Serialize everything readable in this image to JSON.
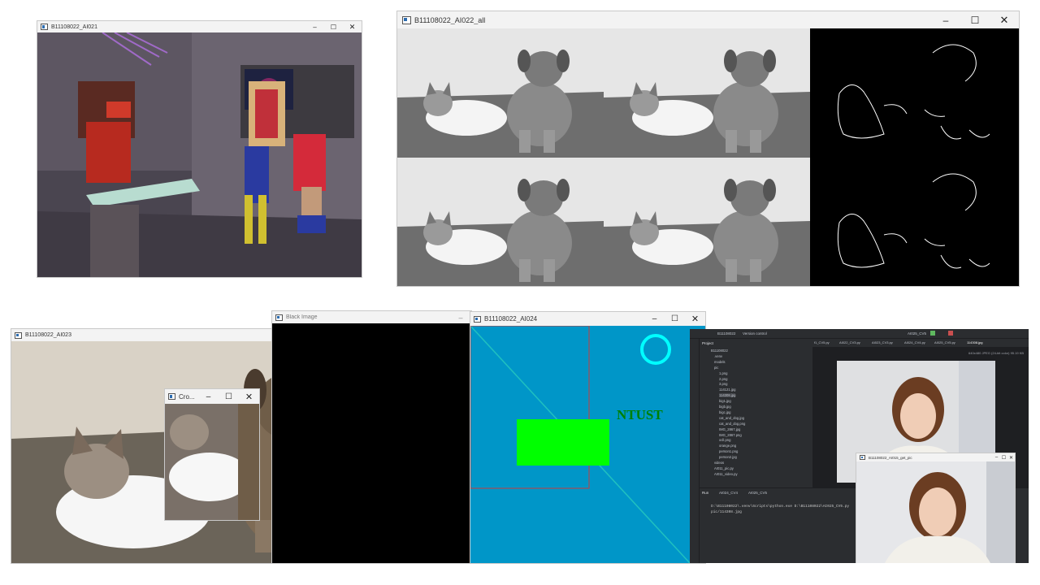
{
  "windows": {
    "ai021": {
      "title": "B11108022_AI021"
    },
    "ai022": {
      "title": "B11108022_AI022_all"
    },
    "ai023": {
      "title": "B11108022_AI023",
      "crop_title": "Cro..."
    },
    "black": {
      "title": "Black Image"
    },
    "ai024": {
      "title": "B11108022_AI024",
      "text": "NTUST"
    },
    "ide": {
      "project_label": "Project",
      "branch": "B11108022",
      "vcs": "Version control",
      "run_config": "AI025_CV5",
      "tabs": [
        "f1_CV5.py",
        "AI022_CV3.py",
        "AI023_CV3.py",
        "AI024_CV4.py",
        "AI025_CV5.py",
        "114308.jpg"
      ],
      "image_info": "640x480 JPEG (24-bit color) 95.19 KB",
      "tree": [
        "B11108022",
        ".venv",
        "models",
        "pic",
        "1.png",
        "2.png",
        "3.png",
        "114121.jpg",
        "114308.jpg",
        "big1.jpg",
        "bigb.jpg",
        "bigc.jpg",
        "cat_and_dog.jpg",
        "cat_and_dog.png",
        "IMG_2867.jpg",
        "IMG_2867.png",
        "ocll.png",
        "orange.png",
        "person1.png",
        "person2.jpg",
        "videos",
        "AI011_pic.py",
        "AI011_video.py"
      ],
      "run_label": "Run",
      "run_tabs": [
        "AI024_CV4",
        "AI025_CV5"
      ],
      "console": [
        "D:\\B11108022\\.venv\\Scripts\\python.exe D:\\B11108022\\AI025_CV5.py",
        "pic/114308.jpg"
      ],
      "popup_title": "B11108022_AI015_get_pic"
    }
  },
  "icons": [
    "minimize-icon",
    "maximize-icon",
    "close-icon",
    "window-app-icon"
  ],
  "colors": {
    "ai024_bg": "#0096c8",
    "rect": "#00ff00",
    "circle": "#00ffff",
    "ntust": "#008000",
    "ide_bg": "#2b2d30"
  }
}
